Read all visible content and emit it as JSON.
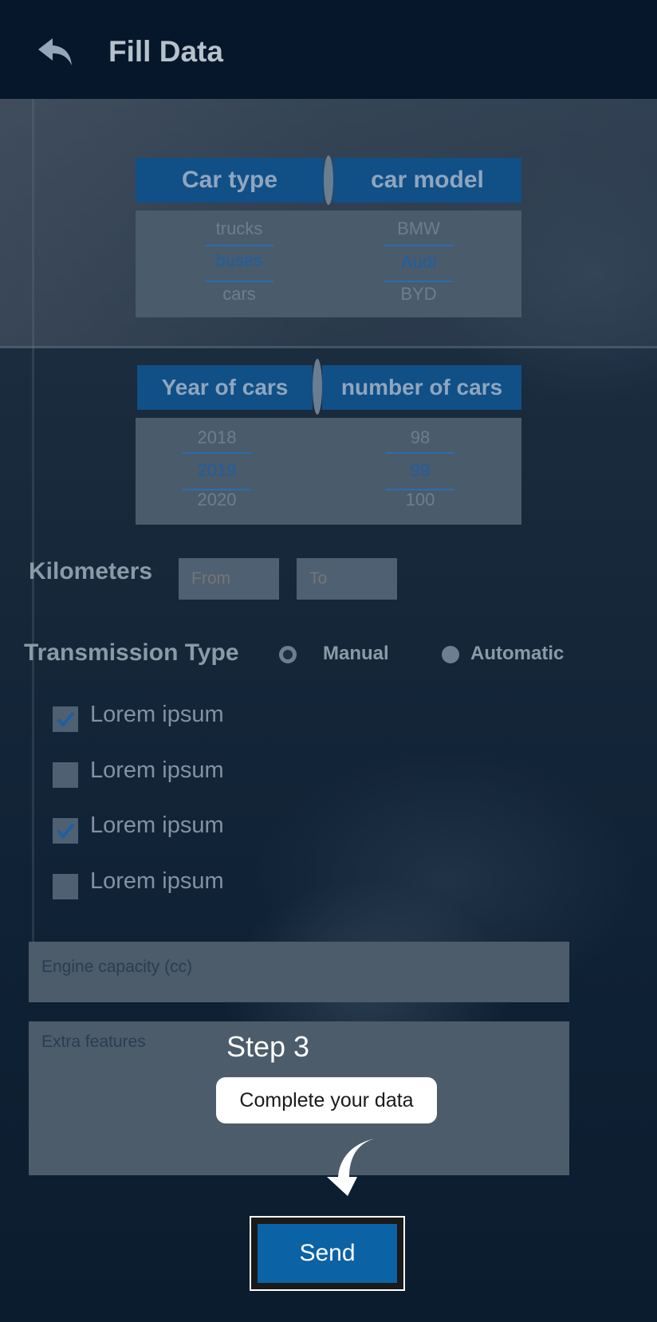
{
  "header": {
    "title": "Fill Data",
    "back_icon": "back-arrow-icon"
  },
  "picker1": {
    "col1_header": "Car type",
    "col2_header": "car model",
    "col1_items": [
      "trucks",
      "buses",
      "cars"
    ],
    "col2_items": [
      "BMW",
      "Audi",
      "BYD"
    ],
    "col1_selected": "buses",
    "col2_selected": "Audi"
  },
  "picker2": {
    "col1_header": "Year of cars",
    "col2_header": "number of cars",
    "col1_items": [
      "2018",
      "2019",
      "2020"
    ],
    "col2_items": [
      "98",
      "99",
      "100"
    ],
    "col1_selected": "2019",
    "col2_selected": "99"
  },
  "kilometers": {
    "label": "Kilometers",
    "from_placeholder": "From",
    "to_placeholder": "To"
  },
  "transmission": {
    "label": "Transmission Type",
    "options": [
      "Manual",
      "Automatic"
    ],
    "selected": "Manual"
  },
  "checkboxes": [
    {
      "label": "Lorem ipsum",
      "checked": true
    },
    {
      "label": "Lorem ipsum",
      "checked": false
    },
    {
      "label": "Lorem ipsum",
      "checked": true
    },
    {
      "label": "Lorem ipsum",
      "checked": false
    }
  ],
  "engine": {
    "placeholder": "Engine capacity (cc)"
  },
  "extra": {
    "placeholder": "Extra features"
  },
  "tutorial": {
    "step": "Step 3",
    "message": "Complete your data"
  },
  "send": {
    "label": "Send"
  },
  "colors": {
    "accent": "#114f87",
    "button": "#0b62a4",
    "header_bg": "#06172b"
  }
}
